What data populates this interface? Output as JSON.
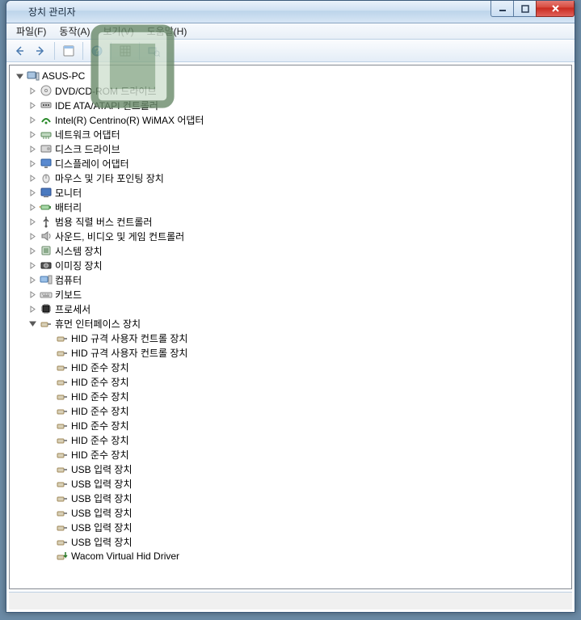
{
  "window": {
    "title": "장치 관리자"
  },
  "menu": {
    "file": "파일(F)",
    "action": "동작(A)",
    "view": "보기(V)",
    "help": "도움말(H)"
  },
  "tree": {
    "root": {
      "label": "ASUS-PC",
      "expanded": true,
      "icon": "pc"
    },
    "categories": [
      {
        "label": "DVD/CD-ROM 드라이브",
        "icon": "disc",
        "expanded": false
      },
      {
        "label": "IDE ATA/ATAPI 컨트롤러",
        "icon": "ide",
        "expanded": false
      },
      {
        "label": "Intel(R) Centrino(R) WiMAX 어댑터",
        "icon": "wimax",
        "expanded": false
      },
      {
        "label": "네트워크 어댑터",
        "icon": "net",
        "expanded": false
      },
      {
        "label": "디스크 드라이브",
        "icon": "disk",
        "expanded": false
      },
      {
        "label": "디스플레이 어댑터",
        "icon": "display",
        "expanded": false
      },
      {
        "label": "마우스 및 기타 포인팅 장치",
        "icon": "mouse",
        "expanded": false
      },
      {
        "label": "모니터",
        "icon": "monitor",
        "expanded": false
      },
      {
        "label": "배터리",
        "icon": "battery",
        "expanded": false
      },
      {
        "label": "범용 직렬 버스 컨트롤러",
        "icon": "usb",
        "expanded": false
      },
      {
        "label": "사운드, 비디오 및 게임 컨트롤러",
        "icon": "sound",
        "expanded": false
      },
      {
        "label": "시스템 장치",
        "icon": "system",
        "expanded": false
      },
      {
        "label": "이미징 장치",
        "icon": "imaging",
        "expanded": false
      },
      {
        "label": "컴퓨터",
        "icon": "computer",
        "expanded": false
      },
      {
        "label": "키보드",
        "icon": "keyboard",
        "expanded": false
      },
      {
        "label": "프로세서",
        "icon": "cpu",
        "expanded": false
      },
      {
        "label": "휴먼 인터페이스 장치",
        "icon": "hid",
        "expanded": true,
        "children": [
          {
            "label": "HID 규격 사용자 컨트롤 장치",
            "icon": "hid"
          },
          {
            "label": "HID 규격 사용자 컨트롤 장치",
            "icon": "hid"
          },
          {
            "label": "HID 준수 장치",
            "icon": "hid"
          },
          {
            "label": "HID 준수 장치",
            "icon": "hid"
          },
          {
            "label": "HID 준수 장치",
            "icon": "hid"
          },
          {
            "label": "HID 준수 장치",
            "icon": "hid"
          },
          {
            "label": "HID 준수 장치",
            "icon": "hid"
          },
          {
            "label": "HID 준수 장치",
            "icon": "hid"
          },
          {
            "label": "HID 준수 장치",
            "icon": "hid"
          },
          {
            "label": "USB 입력 장치",
            "icon": "hid"
          },
          {
            "label": "USB 입력 장치",
            "icon": "hid"
          },
          {
            "label": "USB 입력 장치",
            "icon": "hid"
          },
          {
            "label": "USB 입력 장치",
            "icon": "hid"
          },
          {
            "label": "USB 입력 장치",
            "icon": "hid"
          },
          {
            "label": "USB 입력 장치",
            "icon": "hid"
          },
          {
            "label": "Wacom Virtual Hid Driver",
            "icon": "hid-dl"
          }
        ]
      }
    ]
  }
}
